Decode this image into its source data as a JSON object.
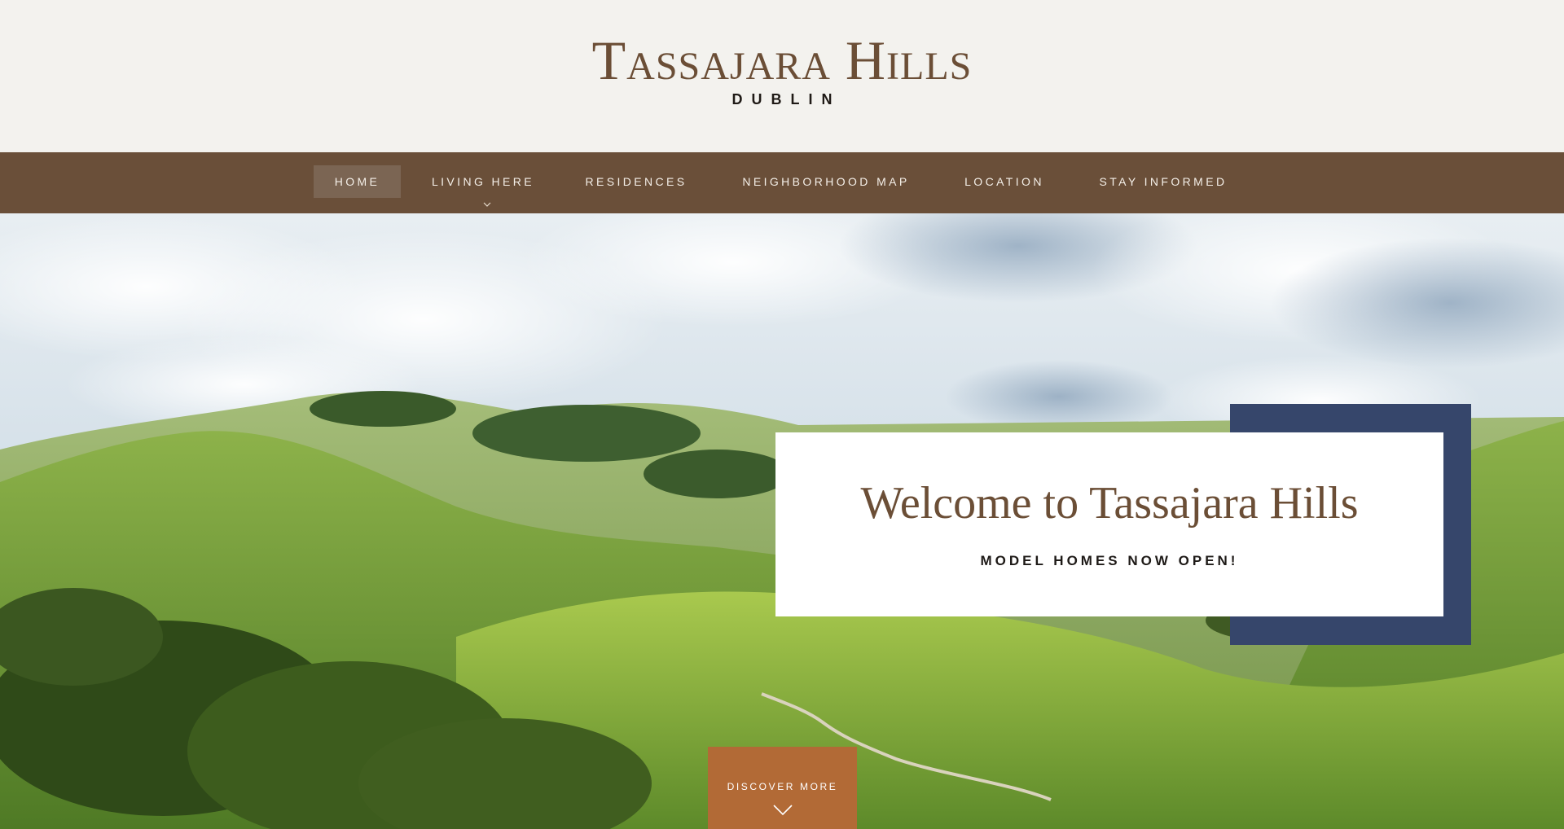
{
  "header": {
    "title": "Tassajara Hills",
    "subtitle": "DUBLIN"
  },
  "nav": {
    "items": [
      {
        "label": "HOME",
        "active": true
      },
      {
        "label": "LIVING HERE",
        "has_submenu": true
      },
      {
        "label": "RESIDENCES"
      },
      {
        "label": "NEIGHBORHOOD MAP"
      },
      {
        "label": "LOCATION"
      },
      {
        "label": "STAY INFORMED"
      }
    ],
    "submenu_icon": "chevron-down-icon"
  },
  "hero": {
    "welcome_title": "Welcome to Tassajara Hills",
    "welcome_subtitle": "MODEL HOMES NOW OPEN!",
    "discover_label": "DISCOVER MORE",
    "discover_icon": "chevron-down-icon"
  },
  "colors": {
    "header_bg": "#f3f2ee",
    "nav_bg": "#6a4f39",
    "brand_brown": "#6b4e36",
    "accent_navy": "#36466b",
    "button_orange": "#b26a36"
  }
}
